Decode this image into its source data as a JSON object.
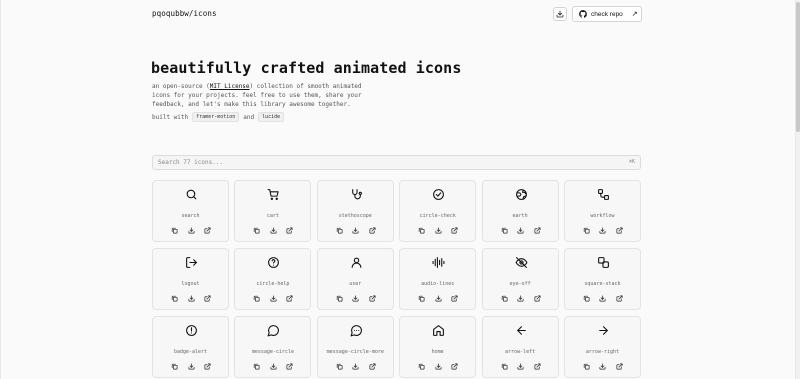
{
  "header": {
    "brand": "pqoqubbw/icons",
    "repo_button": "check repo",
    "repo_arrow": "↗"
  },
  "hero": {
    "title": "beautifully crafted animated icons",
    "desc_line1_pre": "an open-source (",
    "desc_license": "MIT License",
    "desc_line1_post": ") collection of smooth animated",
    "desc_line2": "icons for your projects. feel free to use them, share your",
    "desc_line3": "feedback, and let's make this library awesome together.",
    "built_with": "built with",
    "lib1": "framer-motion",
    "and": "and",
    "lib2": "lucide"
  },
  "search": {
    "placeholder": "Search 77 icons...",
    "shortcut": "⌘K"
  },
  "icons": [
    {
      "name": "search",
      "glyph": "search-icon"
    },
    {
      "name": "cart",
      "glyph": "cart-icon"
    },
    {
      "name": "stethoscope",
      "glyph": "stethoscope-icon"
    },
    {
      "name": "circle-check",
      "glyph": "circle-check-icon"
    },
    {
      "name": "earth",
      "glyph": "earth-icon"
    },
    {
      "name": "workflow",
      "glyph": "workflow-icon"
    },
    {
      "name": "logout",
      "glyph": "logout-icon"
    },
    {
      "name": "circle-help",
      "glyph": "circle-help-icon"
    },
    {
      "name": "user",
      "glyph": "user-icon"
    },
    {
      "name": "audio-lines",
      "glyph": "audio-lines-icon"
    },
    {
      "name": "eye-off",
      "glyph": "eye-off-icon"
    },
    {
      "name": "square-stack",
      "glyph": "square-stack-icon"
    },
    {
      "name": "badge-alert",
      "glyph": "badge-alert-icon"
    },
    {
      "name": "message-circle",
      "glyph": "message-circle-icon"
    },
    {
      "name": "message-circle-more",
      "glyph": "message-circle-more-icon"
    },
    {
      "name": "home",
      "glyph": "home-icon"
    },
    {
      "name": "arrow-left",
      "glyph": "arrow-left-icon"
    },
    {
      "name": "arrow-right",
      "glyph": "arrow-right-icon"
    }
  ]
}
